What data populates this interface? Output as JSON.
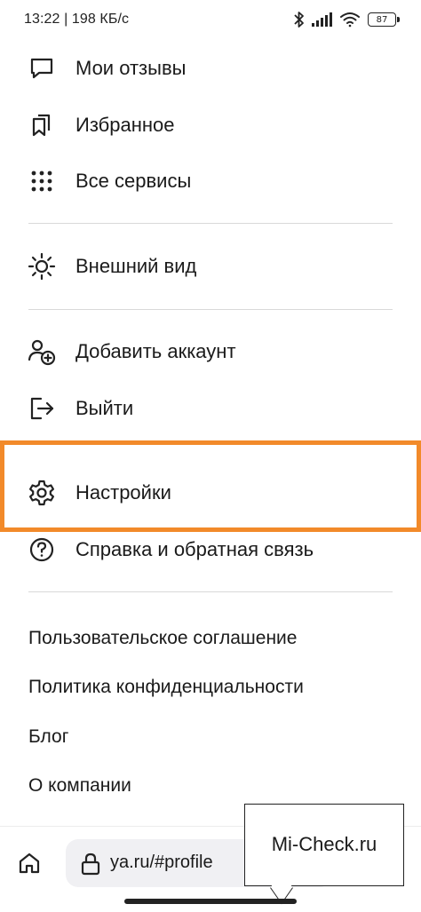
{
  "status_bar": {
    "time_speed": "13:22 | 198 КБ/с",
    "battery": "87"
  },
  "menu": {
    "reviews": "Мои отзывы",
    "favorites": "Избранное",
    "all_services": "Все сервисы",
    "appearance": "Внешний вид",
    "add_account": "Добавить аккаунт",
    "logout": "Выйти",
    "settings": "Настройки",
    "help": "Справка и обратная связь"
  },
  "links": {
    "user_agreement": "Пользовательское соглашение",
    "privacy_policy": "Политика конфиденциальности",
    "blog": "Блог",
    "about": "О компании"
  },
  "bottom_bar": {
    "url": "ya.ru/#profile"
  },
  "watermark": {
    "text": "Mi-Check.ru"
  },
  "colors": {
    "highlight": "#f28a2a"
  }
}
